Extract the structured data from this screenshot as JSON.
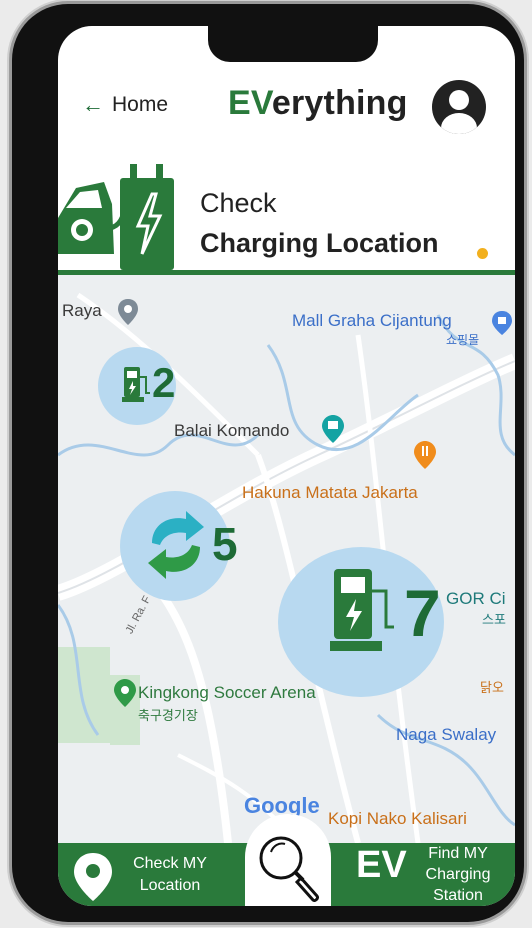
{
  "nav": {
    "back_label": "Home",
    "brand_ev": "EV",
    "brand_rest": "erything"
  },
  "header": {
    "line1": "Check",
    "line2": "Charging Location"
  },
  "map": {
    "labels": {
      "raya": "Raya",
      "mall": "Mall Graha Cijantung",
      "mall_kr": "쇼핑몰",
      "balai": "Balai Komando",
      "hakuna": "Hakuna Matata Jakarta",
      "gor": "GOR Ci",
      "gor_kr": "스포",
      "kingkong": "Kingkong Soccer Arena",
      "kingkong_kr": "축구경기장",
      "naga": "Naga Swalay",
      "dakgo": "닭오",
      "kopi": "Kopi Nako Kalisari",
      "google": "Google",
      "road": "Jl. Ra. F"
    },
    "clusters": {
      "small": "2",
      "swap": "5",
      "large": "7"
    }
  },
  "bottom_bar": {
    "check_location": "Check MY Location",
    "find_station": "Find MY Charging Station",
    "ev_label": "EV"
  },
  "colors": {
    "brand_green": "#2a7a3b",
    "cluster_blue": "#b8d9f0",
    "accent_yellow": "#f2b01e"
  }
}
